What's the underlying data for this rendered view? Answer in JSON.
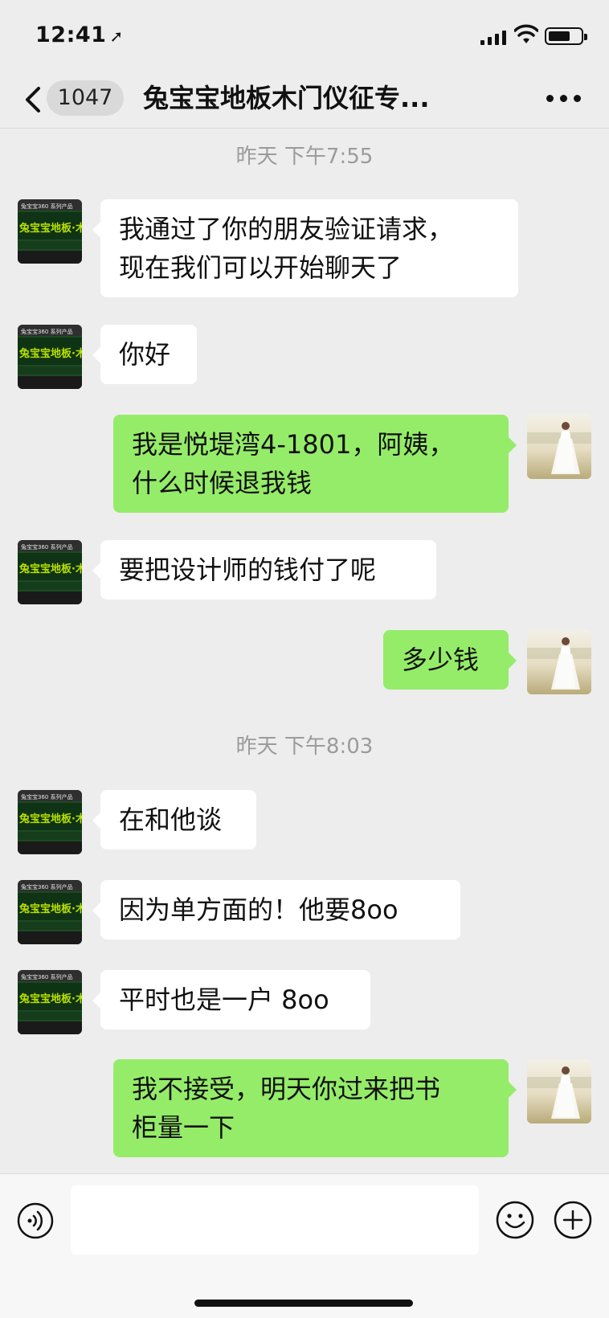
{
  "status": {
    "time": "12:41"
  },
  "nav": {
    "unread_count": "1047",
    "title": "兔宝宝地板木门仪征专..."
  },
  "messages": [
    {
      "type": "timestamp",
      "text": "昨天 下午7:55"
    },
    {
      "type": "incoming",
      "lines": [
        "我通过了你的朋友验证请求，",
        "现在我们可以开始聊天了"
      ]
    },
    {
      "type": "incoming",
      "lines": [
        "你好"
      ]
    },
    {
      "type": "outgoing",
      "lines": [
        "我是悦堤湾4-1801，阿姨，",
        "什么时候退我钱"
      ]
    },
    {
      "type": "incoming",
      "lines": [
        "要把设计师的钱付了呢"
      ]
    },
    {
      "type": "outgoing",
      "lines": [
        "多少钱"
      ]
    },
    {
      "type": "timestamp",
      "text": "昨天 下午8:03"
    },
    {
      "type": "incoming",
      "lines": [
        "在和他谈"
      ]
    },
    {
      "type": "incoming",
      "lines": [
        "因为单方面的！他要8oo"
      ]
    },
    {
      "type": "incoming",
      "lines": [
        "平时也是一户 8oo"
      ]
    },
    {
      "type": "outgoing",
      "lines": [
        "我不接受，明天你过来把书",
        "柜量一下"
      ]
    }
  ],
  "contact_avatar": {
    "brand_text": "兔宝宝地板·木门",
    "top_text": "兔宝宝360 系列产品",
    "accent": "#b8e000",
    "bg": "#1d4a22"
  },
  "colors": {
    "background": "#ededed",
    "bubble_out": "#95ec69",
    "bubble_in": "#ffffff"
  }
}
